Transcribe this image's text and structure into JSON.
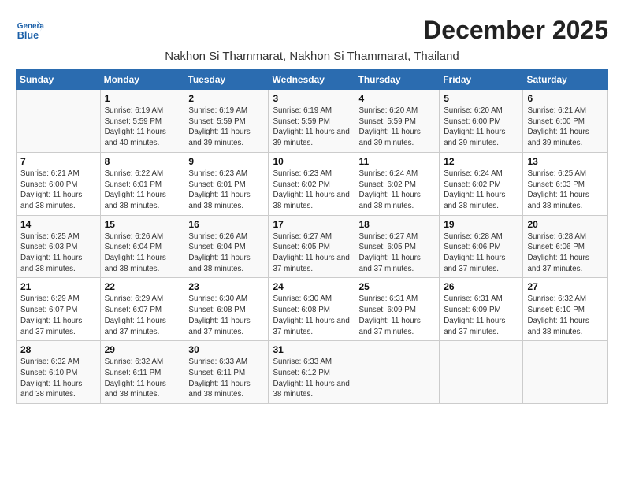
{
  "logo": {
    "general": "General",
    "blue": "Blue"
  },
  "header": {
    "month": "December 2025",
    "location": "Nakhon Si Thammarat, Nakhon Si Thammarat, Thailand"
  },
  "weekdays": [
    "Sunday",
    "Monday",
    "Tuesday",
    "Wednesday",
    "Thursday",
    "Friday",
    "Saturday"
  ],
  "weeks": [
    [
      {
        "day": "",
        "sunrise": "",
        "sunset": "",
        "daylight": ""
      },
      {
        "day": "1",
        "sunrise": "Sunrise: 6:19 AM",
        "sunset": "Sunset: 5:59 PM",
        "daylight": "Daylight: 11 hours and 40 minutes."
      },
      {
        "day": "2",
        "sunrise": "Sunrise: 6:19 AM",
        "sunset": "Sunset: 5:59 PM",
        "daylight": "Daylight: 11 hours and 39 minutes."
      },
      {
        "day": "3",
        "sunrise": "Sunrise: 6:19 AM",
        "sunset": "Sunset: 5:59 PM",
        "daylight": "Daylight: 11 hours and 39 minutes."
      },
      {
        "day": "4",
        "sunrise": "Sunrise: 6:20 AM",
        "sunset": "Sunset: 5:59 PM",
        "daylight": "Daylight: 11 hours and 39 minutes."
      },
      {
        "day": "5",
        "sunrise": "Sunrise: 6:20 AM",
        "sunset": "Sunset: 6:00 PM",
        "daylight": "Daylight: 11 hours and 39 minutes."
      },
      {
        "day": "6",
        "sunrise": "Sunrise: 6:21 AM",
        "sunset": "Sunset: 6:00 PM",
        "daylight": "Daylight: 11 hours and 39 minutes."
      }
    ],
    [
      {
        "day": "7",
        "sunrise": "Sunrise: 6:21 AM",
        "sunset": "Sunset: 6:00 PM",
        "daylight": "Daylight: 11 hours and 38 minutes."
      },
      {
        "day": "8",
        "sunrise": "Sunrise: 6:22 AM",
        "sunset": "Sunset: 6:01 PM",
        "daylight": "Daylight: 11 hours and 38 minutes."
      },
      {
        "day": "9",
        "sunrise": "Sunrise: 6:23 AM",
        "sunset": "Sunset: 6:01 PM",
        "daylight": "Daylight: 11 hours and 38 minutes."
      },
      {
        "day": "10",
        "sunrise": "Sunrise: 6:23 AM",
        "sunset": "Sunset: 6:02 PM",
        "daylight": "Daylight: 11 hours and 38 minutes."
      },
      {
        "day": "11",
        "sunrise": "Sunrise: 6:24 AM",
        "sunset": "Sunset: 6:02 PM",
        "daylight": "Daylight: 11 hours and 38 minutes."
      },
      {
        "day": "12",
        "sunrise": "Sunrise: 6:24 AM",
        "sunset": "Sunset: 6:02 PM",
        "daylight": "Daylight: 11 hours and 38 minutes."
      },
      {
        "day": "13",
        "sunrise": "Sunrise: 6:25 AM",
        "sunset": "Sunset: 6:03 PM",
        "daylight": "Daylight: 11 hours and 38 minutes."
      }
    ],
    [
      {
        "day": "14",
        "sunrise": "Sunrise: 6:25 AM",
        "sunset": "Sunset: 6:03 PM",
        "daylight": "Daylight: 11 hours and 38 minutes."
      },
      {
        "day": "15",
        "sunrise": "Sunrise: 6:26 AM",
        "sunset": "Sunset: 6:04 PM",
        "daylight": "Daylight: 11 hours and 38 minutes."
      },
      {
        "day": "16",
        "sunrise": "Sunrise: 6:26 AM",
        "sunset": "Sunset: 6:04 PM",
        "daylight": "Daylight: 11 hours and 38 minutes."
      },
      {
        "day": "17",
        "sunrise": "Sunrise: 6:27 AM",
        "sunset": "Sunset: 6:05 PM",
        "daylight": "Daylight: 11 hours and 37 minutes."
      },
      {
        "day": "18",
        "sunrise": "Sunrise: 6:27 AM",
        "sunset": "Sunset: 6:05 PM",
        "daylight": "Daylight: 11 hours and 37 minutes."
      },
      {
        "day": "19",
        "sunrise": "Sunrise: 6:28 AM",
        "sunset": "Sunset: 6:06 PM",
        "daylight": "Daylight: 11 hours and 37 minutes."
      },
      {
        "day": "20",
        "sunrise": "Sunrise: 6:28 AM",
        "sunset": "Sunset: 6:06 PM",
        "daylight": "Daylight: 11 hours and 37 minutes."
      }
    ],
    [
      {
        "day": "21",
        "sunrise": "Sunrise: 6:29 AM",
        "sunset": "Sunset: 6:07 PM",
        "daylight": "Daylight: 11 hours and 37 minutes."
      },
      {
        "day": "22",
        "sunrise": "Sunrise: 6:29 AM",
        "sunset": "Sunset: 6:07 PM",
        "daylight": "Daylight: 11 hours and 37 minutes."
      },
      {
        "day": "23",
        "sunrise": "Sunrise: 6:30 AM",
        "sunset": "Sunset: 6:08 PM",
        "daylight": "Daylight: 11 hours and 37 minutes."
      },
      {
        "day": "24",
        "sunrise": "Sunrise: 6:30 AM",
        "sunset": "Sunset: 6:08 PM",
        "daylight": "Daylight: 11 hours and 37 minutes."
      },
      {
        "day": "25",
        "sunrise": "Sunrise: 6:31 AM",
        "sunset": "Sunset: 6:09 PM",
        "daylight": "Daylight: 11 hours and 37 minutes."
      },
      {
        "day": "26",
        "sunrise": "Sunrise: 6:31 AM",
        "sunset": "Sunset: 6:09 PM",
        "daylight": "Daylight: 11 hours and 37 minutes."
      },
      {
        "day": "27",
        "sunrise": "Sunrise: 6:32 AM",
        "sunset": "Sunset: 6:10 PM",
        "daylight": "Daylight: 11 hours and 38 minutes."
      }
    ],
    [
      {
        "day": "28",
        "sunrise": "Sunrise: 6:32 AM",
        "sunset": "Sunset: 6:10 PM",
        "daylight": "Daylight: 11 hours and 38 minutes."
      },
      {
        "day": "29",
        "sunrise": "Sunrise: 6:32 AM",
        "sunset": "Sunset: 6:11 PM",
        "daylight": "Daylight: 11 hours and 38 minutes."
      },
      {
        "day": "30",
        "sunrise": "Sunrise: 6:33 AM",
        "sunset": "Sunset: 6:11 PM",
        "daylight": "Daylight: 11 hours and 38 minutes."
      },
      {
        "day": "31",
        "sunrise": "Sunrise: 6:33 AM",
        "sunset": "Sunset: 6:12 PM",
        "daylight": "Daylight: 11 hours and 38 minutes."
      },
      {
        "day": "",
        "sunrise": "",
        "sunset": "",
        "daylight": ""
      },
      {
        "day": "",
        "sunrise": "",
        "sunset": "",
        "daylight": ""
      },
      {
        "day": "",
        "sunrise": "",
        "sunset": "",
        "daylight": ""
      }
    ]
  ]
}
